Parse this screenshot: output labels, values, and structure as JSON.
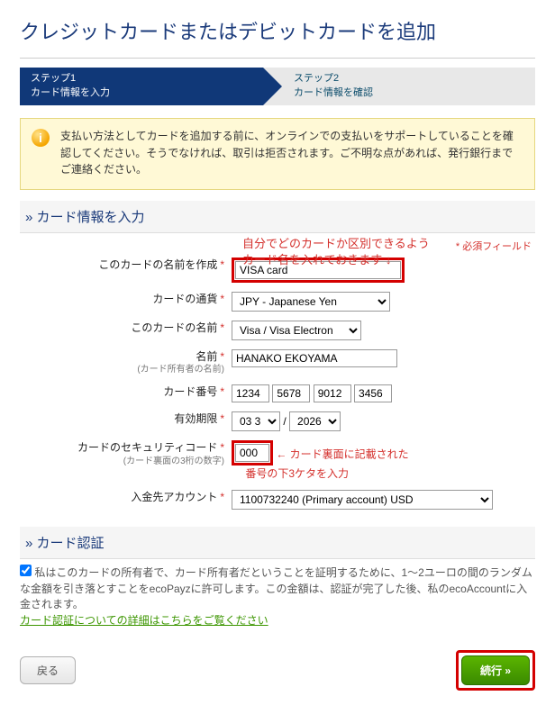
{
  "title": "クレジットカードまたはデビットカードを追加",
  "steps": {
    "s1a": "ステップ1",
    "s1b": "カード情報を入力",
    "s2a": "ステップ2",
    "s2b": "カード情報を確認"
  },
  "alert": "支払い方法としてカードを追加する前に、オンラインでの支払いをサポートしていることを確認してください。そうでなければ、取引は拒否されます。ご不明な点があれば、発行銀行までご連絡ください。",
  "section1": "カード情報を入力",
  "annot1a": "自分でどのカードか区別できるよう",
  "annot1b": "カード名を入れておきます ↓",
  "reqNote": "* 必須フィールド",
  "labels": {
    "cname": "このカードの名前を作成",
    "currency": "カードの通貨",
    "ctype": "このカードの名前",
    "holder": "名前",
    "holderSub": "(カード所有者の名前)",
    "number": "カード番号",
    "expiry": "有効期限",
    "sec": "カードのセキュリティコード",
    "secSub": "(カード裏面の3桁の数字)",
    "acct": "入金先アカウント"
  },
  "values": {
    "cname": "VISA card",
    "currency": "JPY - Japanese Yen",
    "ctype": "Visa / Visa Electron",
    "holder": "HANAKO EKOYAMA",
    "n1": "1234",
    "n2": "5678",
    "n3": "9012",
    "n4": "3456",
    "expM": "03 3",
    "expY": "2026",
    "sec": "000",
    "acct": "1100732240 (Primary account) USD"
  },
  "annot2": "← カード裏面に記載された\n　 番号の下3ケタを入力",
  "section2": "カード認証",
  "authText": "私はこのカードの所有者で、カード所有者だということを証明するために、1～2ユーロの間のランダムな金額を引き落とすことをecoPayzに許可します。この金額は、認証が完了した後、私のecoAccountに入金されます。",
  "authLink": "カード認証についての詳細はこちらをご覧ください",
  "btnBack": "戻る",
  "btnNext": "続行 »"
}
